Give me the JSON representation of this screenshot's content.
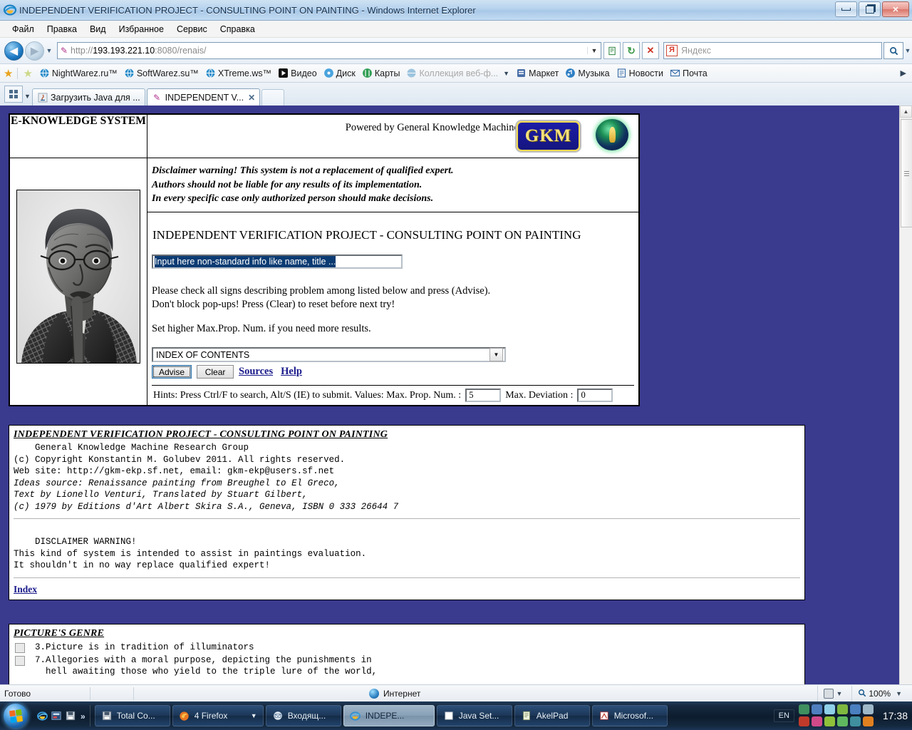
{
  "window": {
    "title": "INDEPENDENT VERIFICATION PROJECT - CONSULTING POINT ON PAINTING - Windows Internet Explorer",
    "app_icon": "ie-icon",
    "minimize_label": "Minimize",
    "maximize_label": "Restore",
    "close_label": "Close"
  },
  "menu": {
    "items": [
      {
        "label": "Файл"
      },
      {
        "label": "Правка"
      },
      {
        "label": "Вид"
      },
      {
        "label": "Избранное"
      },
      {
        "label": "Сервис"
      },
      {
        "label": "Справка"
      }
    ]
  },
  "nav": {
    "back_label": "◀",
    "forward_label": "▶",
    "history_caret": "▼",
    "address_icon": "pen-icon",
    "address_prefix": "http://",
    "address_host": "193.193.221.10",
    "address_suffix": ":8080/renais/",
    "address_caret": "▼",
    "compat_button": "compatibility-view-icon",
    "refresh_button": "↻",
    "stop_button": "✕",
    "search_engine": "Яндекс",
    "search_engine_icon": "Я",
    "search_placeholder": "Яндекс",
    "search_go": "🔍",
    "search_go_caret": "▼"
  },
  "favorites": {
    "add_star": "★",
    "favorites_bar_star": "★",
    "items": [
      {
        "label": "NightWarez.ru™",
        "icon": "globe-icon",
        "dim": false
      },
      {
        "label": "SoftWarez.su™",
        "icon": "globe-icon",
        "dim": false
      },
      {
        "label": "XTreme.ws™",
        "icon": "globe-icon",
        "dim": false
      },
      {
        "label": "Видео",
        "icon": "video-icon",
        "dim": false
      },
      {
        "label": "Диск",
        "icon": "disk-icon",
        "dim": false
      },
      {
        "label": "Карты",
        "icon": "maps-icon",
        "dim": false
      },
      {
        "label": "Коллекция веб-ф...",
        "icon": "globe-icon",
        "dim": true
      },
      {
        "label": "Маркет",
        "icon": "market-icon",
        "dim": false
      },
      {
        "label": "Музыка",
        "icon": "music-icon",
        "dim": false
      },
      {
        "label": "Новости",
        "icon": "news-icon",
        "dim": false
      },
      {
        "label": "Почта",
        "icon": "mail-icon",
        "dim": false
      }
    ],
    "overflow_caret": "▶",
    "collection_caret": "▼"
  },
  "tabs": {
    "quick_tabs_caret": "▼",
    "items": [
      {
        "label": "Загрузить Java для ...",
        "icon": "java-icon",
        "active": false,
        "close": ""
      },
      {
        "label": "INDEPENDENT V...",
        "icon": "pen-icon",
        "active": true,
        "close": "✕"
      }
    ],
    "new_tab_label": ""
  },
  "page": {
    "header": {
      "system_name": "E-KNOWLEDGE SYSTEM",
      "powered_by": "Powered by General Knowledge Machine",
      "logo_text": "GKM",
      "globe_icon": "globe-key-icon"
    },
    "disclaimer_lines": [
      "Disclaimer warning! This system is not a replacement of qualified expert.",
      "Authors should not be liable for any results of its implementation.",
      "In every specific case only authorized person should make decisions."
    ],
    "portrait_alt": "portrait-of-elderly-man-with-glasses",
    "title": "INDEPENDENT VERIFICATION PROJECT - CONSULTING POINT ON PAINTING",
    "text_input": {
      "value": "Input here non-standard info like name, title ...",
      "placeholder": "Input here non-standard info like name, title ...",
      "selected": true
    },
    "instructions": [
      "Please check all signs describing problem among listed below and press (Advise).",
      "Don't block pop-ups! Press (Clear) to reset before next try!"
    ],
    "instructions2": "Set higher Max.Prop. Num. if you need more results.",
    "dropdown": {
      "selected": "INDEX OF CONTENTS",
      "caret": "▼"
    },
    "buttons": {
      "advise": "Advise",
      "clear": "Clear"
    },
    "links": {
      "sources": "Sources",
      "help": "Help"
    },
    "hints": {
      "text": "Hints: Press Ctrl/F to search, Alt/S (IE) to submit. Values: Max. Prop. Num. :",
      "max_prop_num": "5",
      "max_deviation_label": "Max. Deviation :",
      "max_deviation": "0"
    }
  },
  "results": {
    "about": {
      "heading": "INDEPENDENT VERIFICATION PROJECT - CONSULTING POINT ON PAINTING",
      "lines": [
        "    General Knowledge Machine Research Group",
        "(c) Copyright Konstantin M. Golubev 2011. All rights reserved.",
        "Web site: http://gkm-ekp.sf.net, email: gkm-ekp@users.sf.net"
      ],
      "italic_lines": [
        "Ideas source: Renaissance painting from Breughel to El Greco,",
        "Text by Lionello Venturi, Translated by Stuart Gilbert,",
        "(c) 1979 by Editions d'Art Albert Skira S.A., Geneva, ISBN 0 333 26644 7"
      ],
      "disclaimer_heading": "    DISCLAIMER WARNING!",
      "disclaimer_lines": [
        "This kind of system is intended to assist in paintings evaluation.",
        "It shouldn't in no way replace qualified expert!"
      ],
      "index_link": "Index"
    },
    "genre": {
      "heading": "PICTURE'S GENRE",
      "items": [
        {
          "checked": false,
          "text": "3.Picture is in tradition of illuminators"
        },
        {
          "checked": false,
          "text": "7.Allegories with a moral purpose, depicting the punishments in\n  hell awaiting those who yield to the triple lure of the world,"
        }
      ]
    }
  },
  "statusbar": {
    "status": "Готово",
    "zone": "Интернет",
    "zone_icon": "globe-icon",
    "protected_icon": "lock-icon",
    "protected_caret": "▼",
    "zoom_icon": "magnifier-icon",
    "zoom_level": "100%",
    "zoom_caret": "▼"
  },
  "taskbar": {
    "start_label": "start-orb",
    "quick_launch": [
      {
        "icon": "ie-icon",
        "name": "internet-explorer"
      },
      {
        "icon": "app-icon",
        "name": "quick-app"
      },
      {
        "icon": "save-icon",
        "name": "total-commander"
      }
    ],
    "quick_more": "»",
    "buttons": [
      {
        "label": "Total Co...",
        "icon": "tc-icon",
        "active": false,
        "caret": ""
      },
      {
        "label": "4 Firefox",
        "icon": "firefox-icon",
        "active": false,
        "caret": "▼"
      },
      {
        "label": "Входящ...",
        "icon": "mail-icon",
        "active": false,
        "caret": ""
      },
      {
        "label": "INDEPE...",
        "icon": "ie-icon",
        "active": true,
        "caret": ""
      },
      {
        "label": "Java Set...",
        "icon": "java-icon",
        "active": false,
        "caret": ""
      },
      {
        "label": "AkelPad",
        "icon": "notepad-icon",
        "active": false,
        "caret": ""
      },
      {
        "label": "Microsof...",
        "icon": "office-icon",
        "active": false,
        "caret": ""
      }
    ],
    "language": "EN",
    "clock": "17:38"
  },
  "colors": {
    "page_background": "#3a3a8e",
    "link": "#1a1a8c",
    "selection": "#0b3b73",
    "accent_gold": "#f5e07a",
    "logo_blue": "#1c1ca8"
  }
}
